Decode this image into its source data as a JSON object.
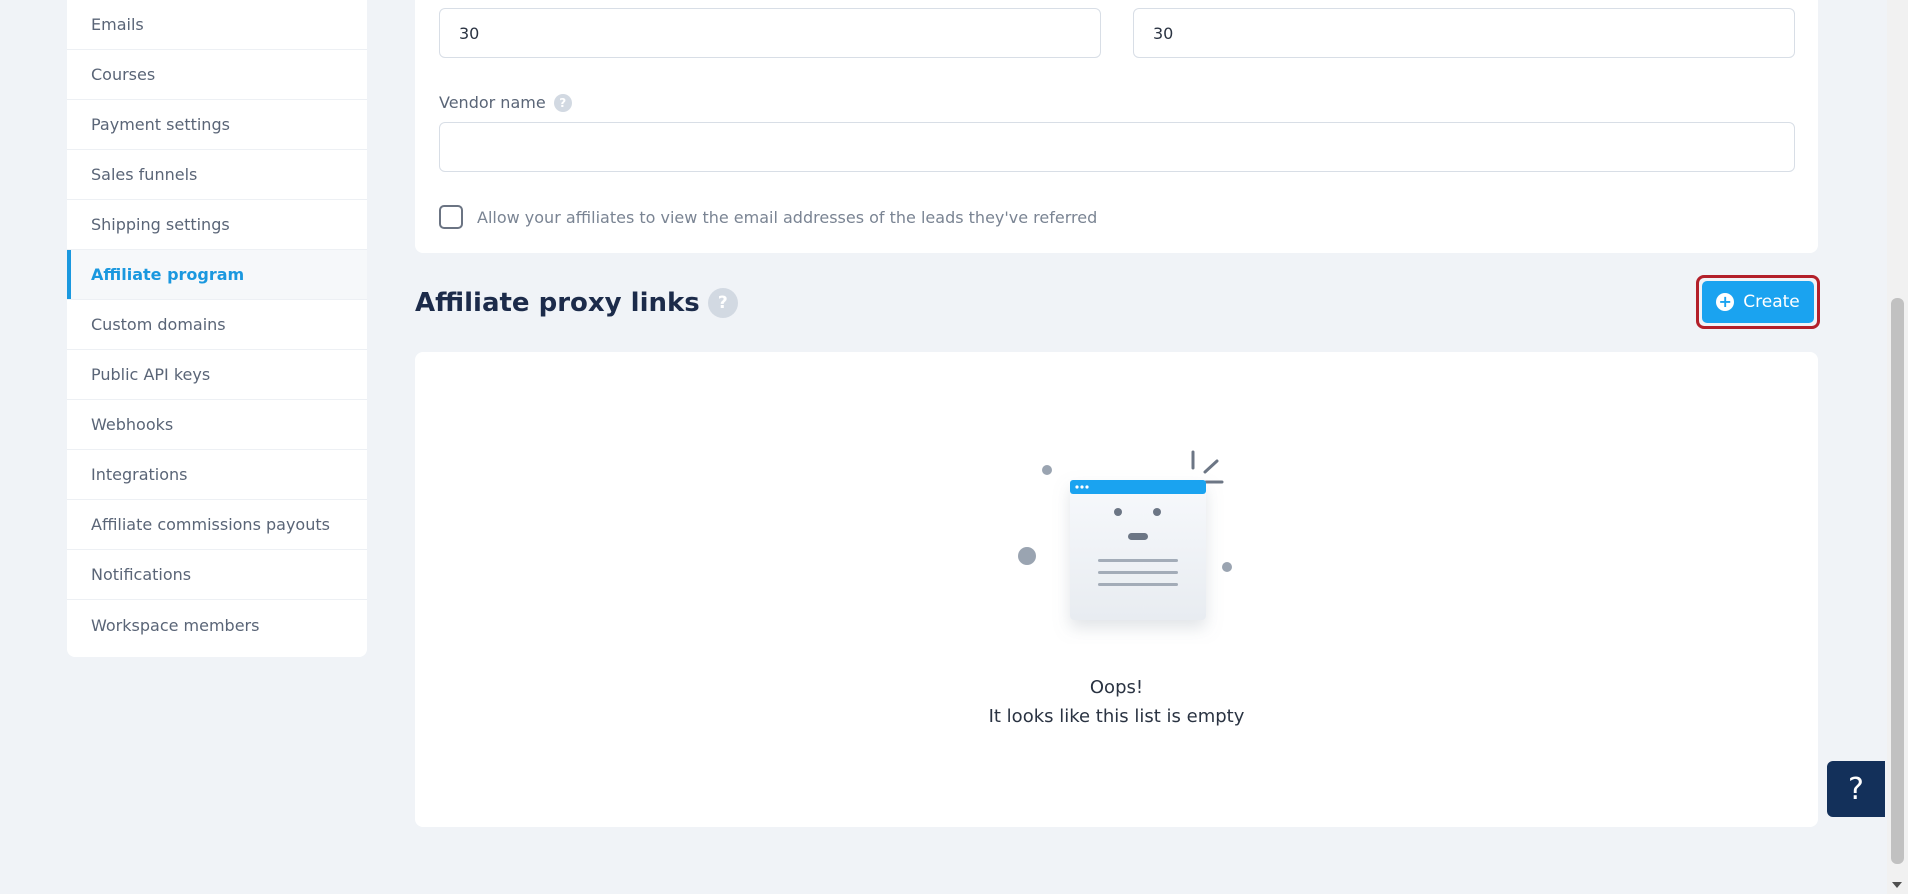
{
  "sidebar": {
    "items": [
      {
        "label": "Emails",
        "active": false
      },
      {
        "label": "Courses",
        "active": false
      },
      {
        "label": "Payment settings",
        "active": false
      },
      {
        "label": "Sales funnels",
        "active": false
      },
      {
        "label": "Shipping settings",
        "active": false
      },
      {
        "label": "Affiliate program",
        "active": true
      },
      {
        "label": "Custom domains",
        "active": false
      },
      {
        "label": "Public API keys",
        "active": false
      },
      {
        "label": "Webhooks",
        "active": false
      },
      {
        "label": "Integrations",
        "active": false
      },
      {
        "label": "Affiliate commissions payouts",
        "active": false
      },
      {
        "label": "Notifications",
        "active": false
      },
      {
        "label": "Workspace members",
        "active": false
      }
    ]
  },
  "settings": {
    "field_left_value": "30",
    "field_right_value": "30",
    "vendor_name_label": "Vendor name",
    "vendor_name_value": "",
    "help_glyph": "?",
    "allow_view_emails_label": "Allow your affiliates to view the email addresses of the leads they've referred",
    "allow_view_emails_checked": false
  },
  "proxy_links": {
    "title": "Affiliate proxy links",
    "help_glyph": "?",
    "create_label": "Create",
    "create_icon": "plus-circle-icon",
    "empty_title": "Oops!",
    "empty_message": "It looks like this list is empty"
  },
  "help_fab": {
    "label": "?"
  },
  "colors": {
    "accent": "#1a98df",
    "create_button": "#1aa3f0",
    "highlight_border": "#b3202a",
    "heading": "#1c2b4a",
    "help_fab": "#13305a",
    "background": "#f0f3f7"
  }
}
